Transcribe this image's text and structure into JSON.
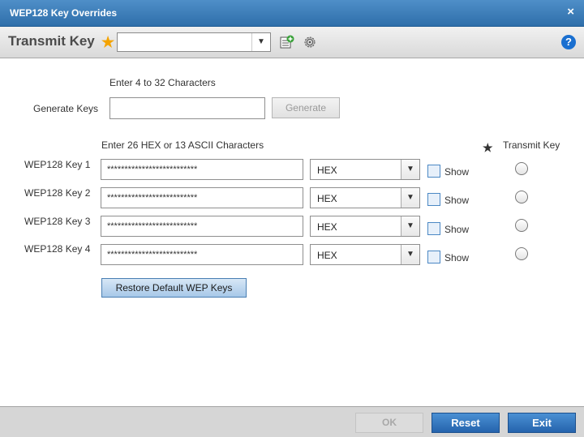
{
  "dialog": {
    "title": "WEP128 Key Overrides",
    "close_icon": "×"
  },
  "toolbar": {
    "label": "Transmit Key",
    "required_mark": "★",
    "select_value": "",
    "arrow": "▼",
    "help": "?"
  },
  "generate": {
    "hint": "Enter 4 to 32 Characters",
    "label": "Generate Keys",
    "value": "",
    "button": "Generate"
  },
  "keys": {
    "hint": "Enter 26 HEX or 13 ASCII Characters",
    "transmit_header": "Transmit Key",
    "required_mark": "★",
    "show_label": "Show",
    "arrow": "▼",
    "rows": [
      {
        "label": "WEP128 Key 1",
        "value": "**************************",
        "format": "HEX"
      },
      {
        "label": "WEP128 Key 2",
        "value": "**************************",
        "format": "HEX"
      },
      {
        "label": "WEP128 Key 3",
        "value": "**************************",
        "format": "HEX"
      },
      {
        "label": "WEP128 Key 4",
        "value": "**************************",
        "format": "HEX"
      }
    ],
    "restore_button": "Restore Default WEP Keys"
  },
  "footer": {
    "ok": "OK",
    "reset": "Reset",
    "exit": "Exit"
  },
  "colors": {
    "titlebar": "#3f80bd",
    "accent": "#2a6cb5",
    "required": "#f4a300"
  }
}
